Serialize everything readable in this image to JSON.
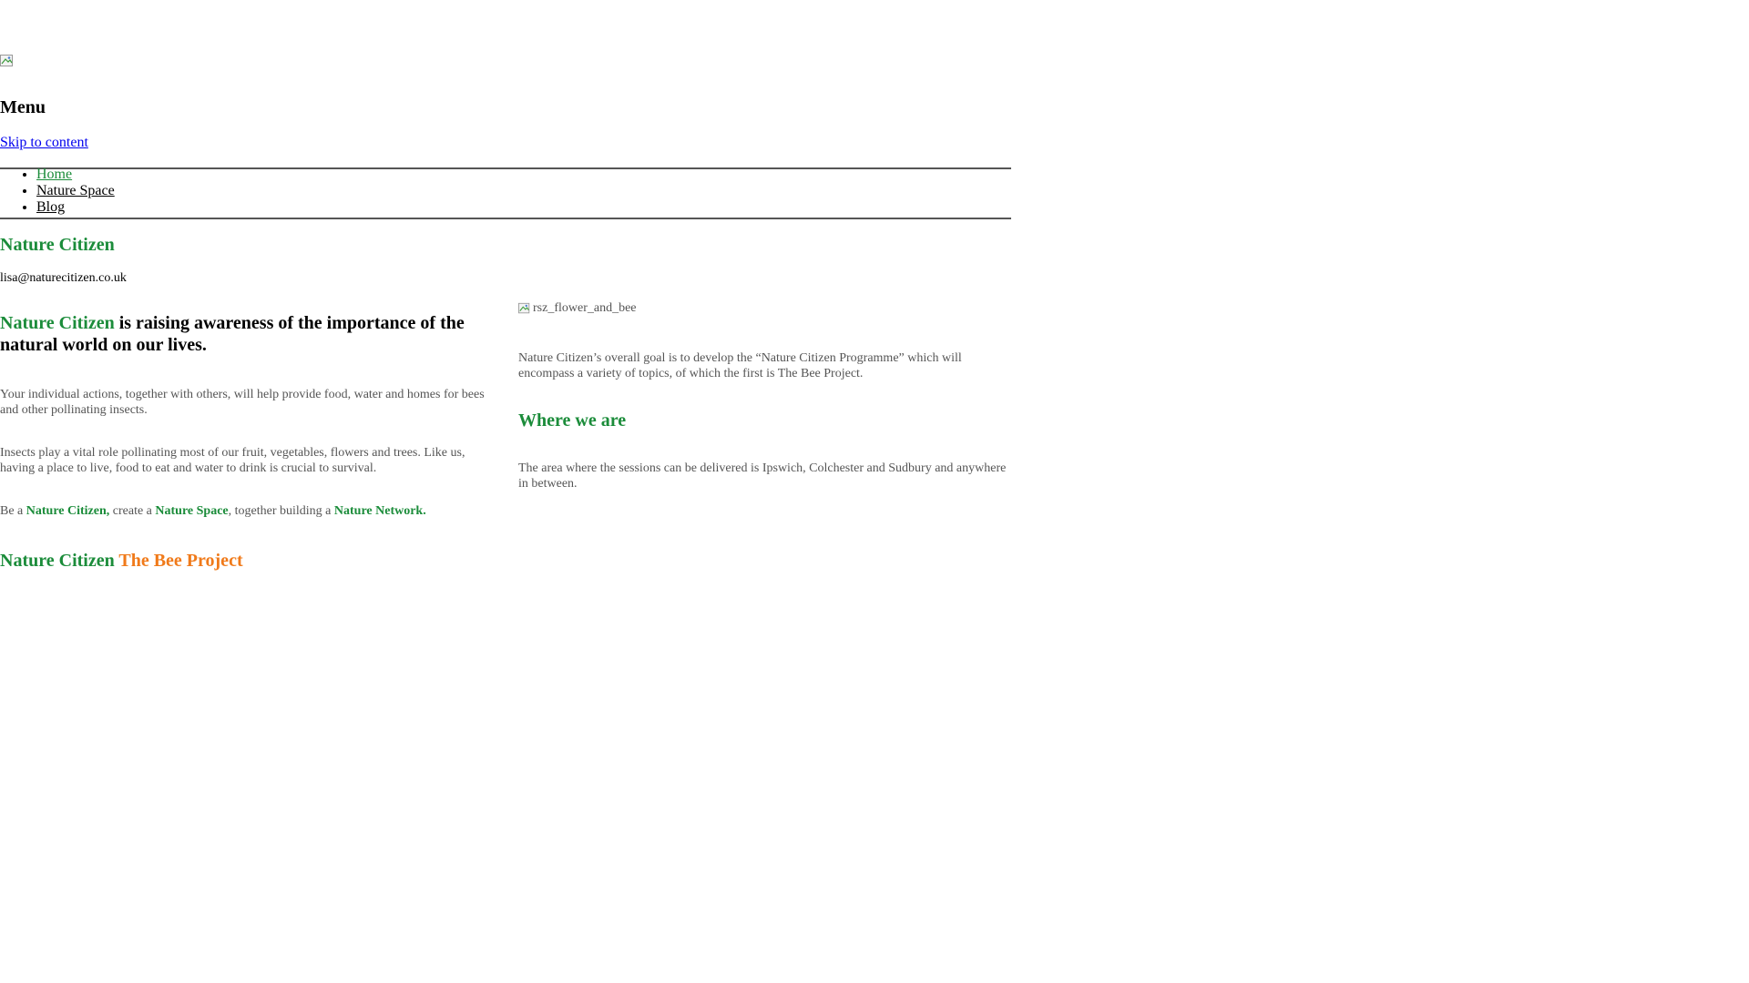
{
  "header": {
    "logo_icon": "broken-image-icon",
    "menu_heading": "Menu",
    "skip_link": "Skip to content"
  },
  "nav": {
    "items": [
      {
        "label": "Home",
        "active": true
      },
      {
        "label": "Nature Space",
        "active": false
      },
      {
        "label": "Blog",
        "active": false
      }
    ]
  },
  "site": {
    "title": "Nature Citizen",
    "email": "lisa@naturecitizen.co.uk"
  },
  "main": {
    "hero_brand": "Nature Citizen",
    "hero_rest": " is raising awareness of the importance of the natural world on our lives.",
    "para1": "Your individual actions, together with others, will help provide food, water and homes for bees and other pollinating insects.",
    "para2": "Insects play a vital role pollinating most of our fruit, vegetables, flowers and trees. Like us, having a place to live, food to eat and water to drink is crucial to survival.",
    "para3": {
      "t1": "Be a ",
      "b1": "Nature Citizen,",
      "t2": " create a ",
      "b2": "Nature Space",
      "t3": ", together building a ",
      "b3": "Nature Network."
    },
    "bee_brand": "Nature Citizen",
    "bee_project": "The Bee Project"
  },
  "aside": {
    "image_alt": "rsz_flower_and_bee",
    "goal": "Nature Citizen’s overall goal is to develop the “Nature Citizen Programme” which will encompass a variety of topics, of which the first is The Bee Project.",
    "where_heading": "Where we are",
    "area": "The area where the sessions can be delivered is Ipswich, Colchester and Sudbury and anywhere in between."
  },
  "colors": {
    "brand_green": "#1b8c3a",
    "accent_orange": "#f07a1a",
    "body_gray": "#555555"
  }
}
